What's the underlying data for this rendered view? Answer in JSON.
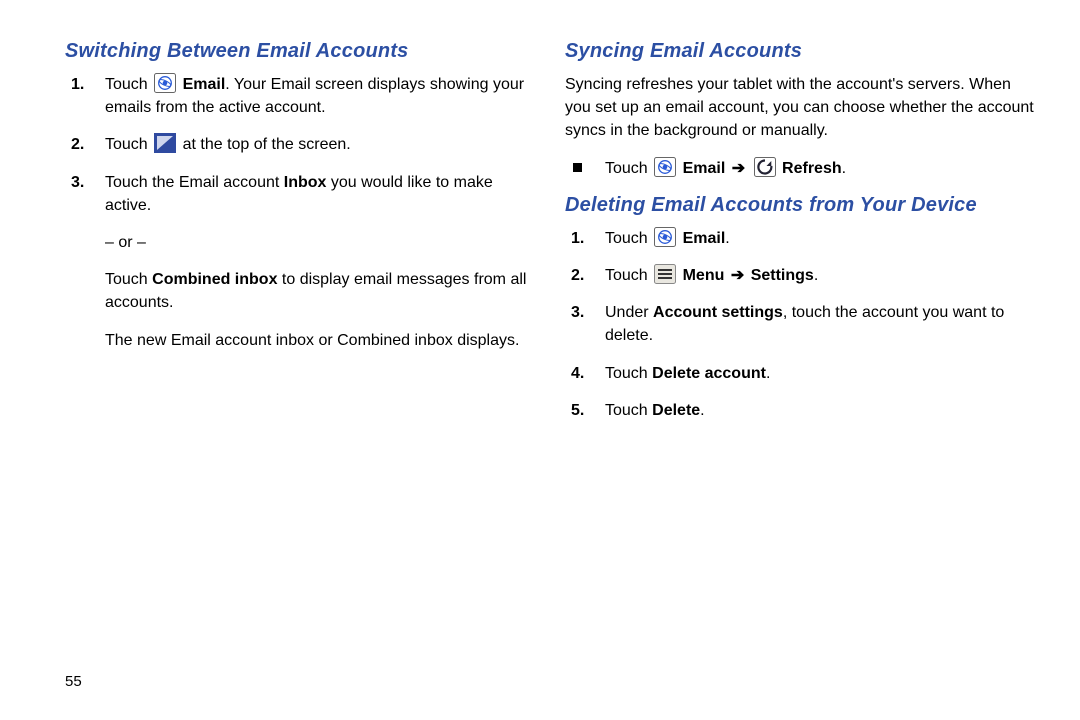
{
  "pageNumber": "55",
  "left": {
    "heading": "Switching Between Email Accounts",
    "step1_a": "Touch ",
    "step1_b": "Email",
    "step1_c": ". Your Email screen displays showing your emails from the active account.",
    "step2_a": "Touch ",
    "step2_b": " at the top of the screen.",
    "step3_a": "Touch the Email account ",
    "step3_b": "Inbox",
    "step3_c": " you would like to make active.",
    "or": "– or –",
    "combined_a": "Touch ",
    "combined_b": "Combined inbox",
    "combined_c": " to display email messages from all accounts.",
    "tail": "The new Email account inbox or Combined inbox displays."
  },
  "right": {
    "syncHeading": "Syncing Email Accounts",
    "syncPara": "Syncing refreshes your tablet with the account's servers. When you set up an email account, you can choose whether the account syncs in the background or manually.",
    "syncStep_a": "Touch ",
    "syncStep_b": "Email",
    "syncStep_arrow": "➔",
    "syncStep_c": "Refresh",
    "syncStep_d": ".",
    "delHeading": "Deleting Email Accounts from Your Device",
    "d1_a": "Touch ",
    "d1_b": "Email",
    "d1_c": ".",
    "d2_a": "Touch ",
    "d2_b": "Menu",
    "d2_arrow": "➔",
    "d2_c": "Settings",
    "d2_d": ".",
    "d3_a": "Under ",
    "d3_b": "Account settings",
    "d3_c": ", touch the account you want to delete.",
    "d4_a": "Touch ",
    "d4_b": "Delete account",
    "d4_c": ".",
    "d5_a": "Touch ",
    "d5_b": "Delete",
    "d5_c": "."
  }
}
